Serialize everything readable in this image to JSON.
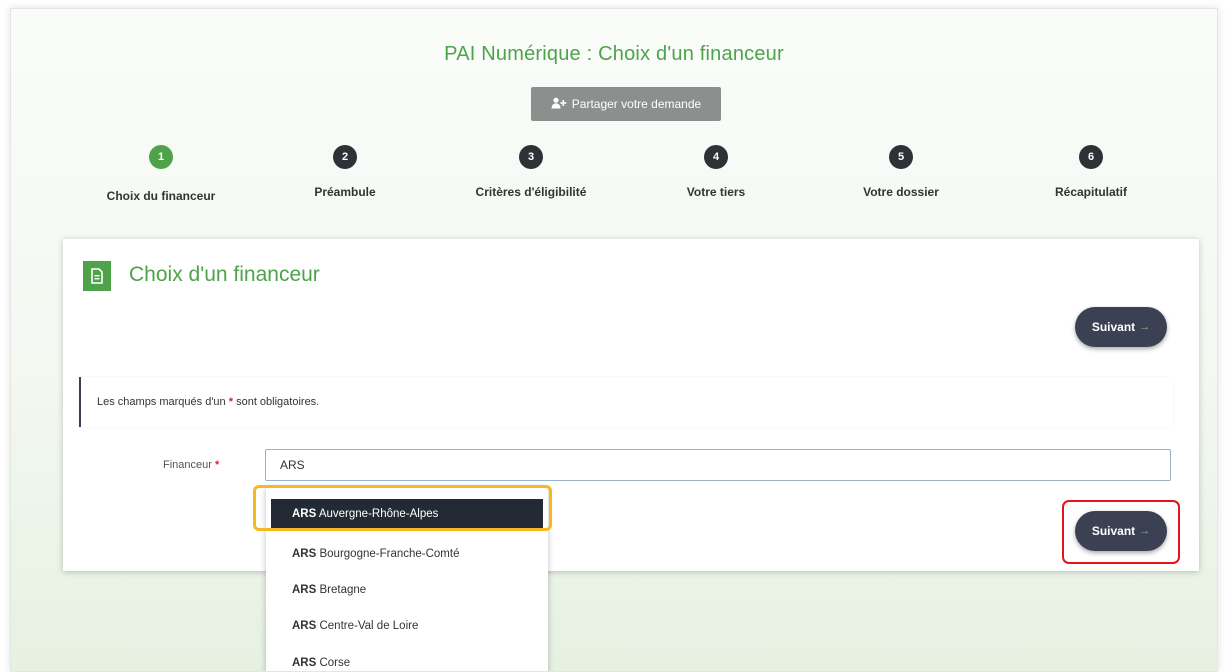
{
  "page_title": "PAI Numérique : Choix d'un financeur",
  "share_button": {
    "label": "Partager votre demande",
    "icon": "user-plus-icon"
  },
  "steps": [
    {
      "number": "1",
      "label": "Choix du financeur",
      "active": true
    },
    {
      "number": "2",
      "label": "Préambule",
      "active": false
    },
    {
      "number": "3",
      "label": "Critères d'éligibilité",
      "active": false
    },
    {
      "number": "4",
      "label": "Votre tiers",
      "active": false
    },
    {
      "number": "5",
      "label": "Votre dossier",
      "active": false
    },
    {
      "number": "6",
      "label": "Récapitulatif",
      "active": false
    }
  ],
  "card": {
    "title": "Choix d'un financeur",
    "icon": "document-icon",
    "next_label": "Suivant",
    "required_note": {
      "before": "Les champs marqués d'un",
      "star": "*",
      "after": "sont obligatoires."
    },
    "field": {
      "label": "Financeur",
      "star": "*",
      "value": "ARS"
    }
  },
  "dropdown": {
    "items": [
      {
        "prefix": "ARS",
        "rest": "Auvergne-Rhône-Alpes",
        "selected": true
      },
      {
        "prefix": "ARS",
        "rest": "Bourgogne-Franche-Comté",
        "selected": false
      },
      {
        "prefix": "ARS",
        "rest": "Bretagne",
        "selected": false
      },
      {
        "prefix": "ARS",
        "rest": "Centre-Val de Loire",
        "selected": false
      },
      {
        "prefix": "ARS",
        "rest": "Corse",
        "selected": false
      }
    ]
  },
  "colors": {
    "accent_green": "#4ea34a",
    "dark_button": "#3b4153",
    "highlight_orange": "#f5b820",
    "highlight_red": "#e0151c",
    "required_red": "#d9232d"
  }
}
